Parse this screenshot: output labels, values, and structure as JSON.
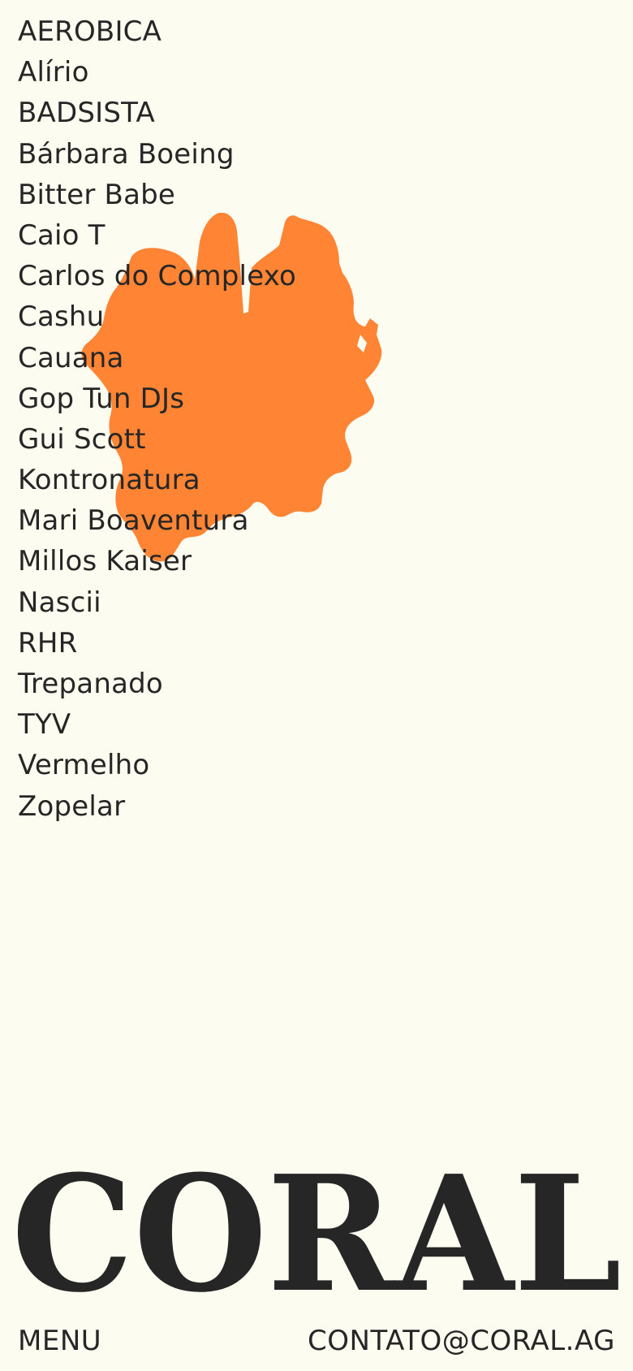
{
  "artists": [
    "AEROBICA",
    "Alírio",
    "BADSISTA",
    "Bárbara Boeing",
    "Bitter Babe",
    "Caio T",
    "Carlos do Complexo",
    "Cashu",
    "Cauana",
    "Gop Tun DJs",
    "Gui Scott",
    "Kontronatura",
    "Mari Boaventura",
    "Millos Kaiser",
    "Nascii",
    "RHR",
    "Trepanado",
    "TYV",
    "Vermelho",
    "Zopelar"
  ],
  "brand": {
    "logo": "CORAL"
  },
  "footer": {
    "menu_label": "MENU",
    "contact_label": "CONTATO@CORAL.AG"
  },
  "colors": {
    "background": "#fcfcf0",
    "text": "#262626",
    "accent_blob": "#ff8433"
  },
  "decor": {
    "blob_icon": "coral-blob-shape"
  }
}
